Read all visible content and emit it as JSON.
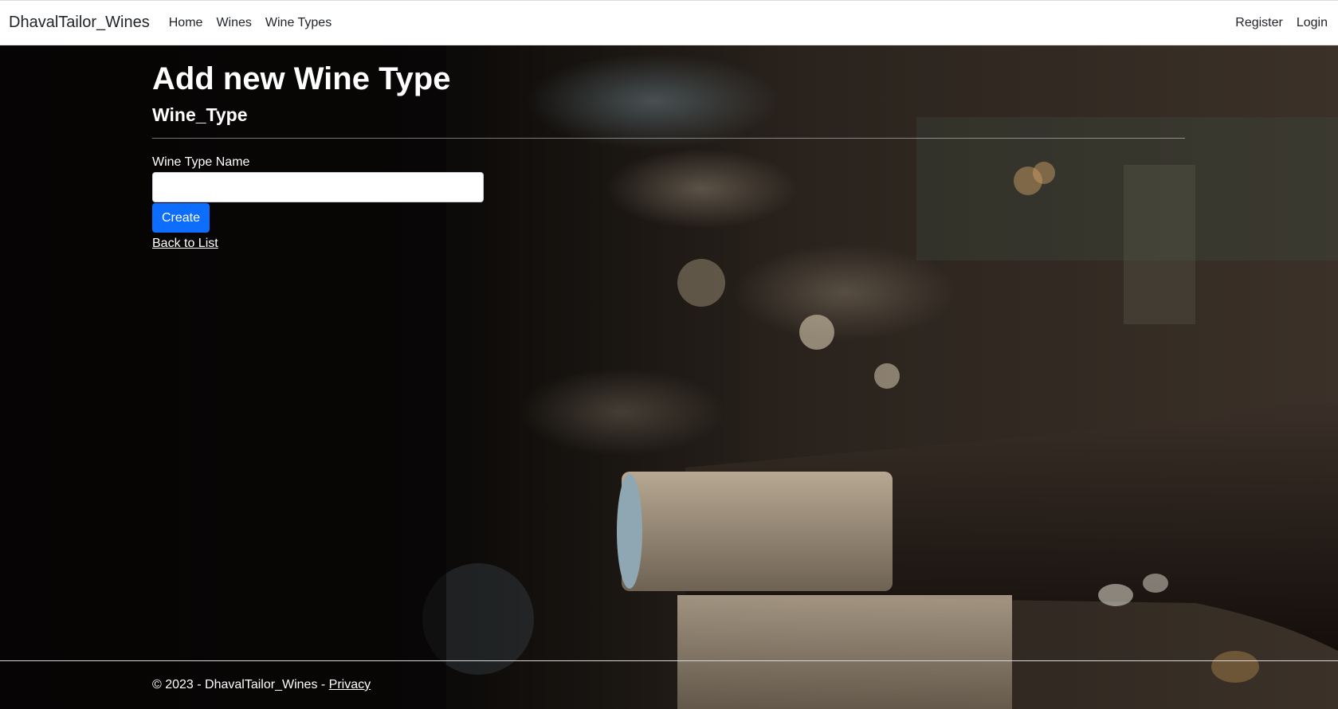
{
  "nav": {
    "brand": "DhavalTailor_Wines",
    "links": [
      "Home",
      "Wines",
      "Wine Types"
    ],
    "right_links": [
      "Register",
      "Login"
    ]
  },
  "main": {
    "title": "Add new Wine Type",
    "subtitle": "Wine_Type",
    "field_label": "Wine Type Name",
    "field_value": "",
    "create_label": "Create",
    "back_link": "Back to List"
  },
  "footer": {
    "copyright": "© 2023 - DhavalTailor_Wines - ",
    "privacy_link": "Privacy"
  },
  "colors": {
    "primary_button": "#0d6efd"
  }
}
